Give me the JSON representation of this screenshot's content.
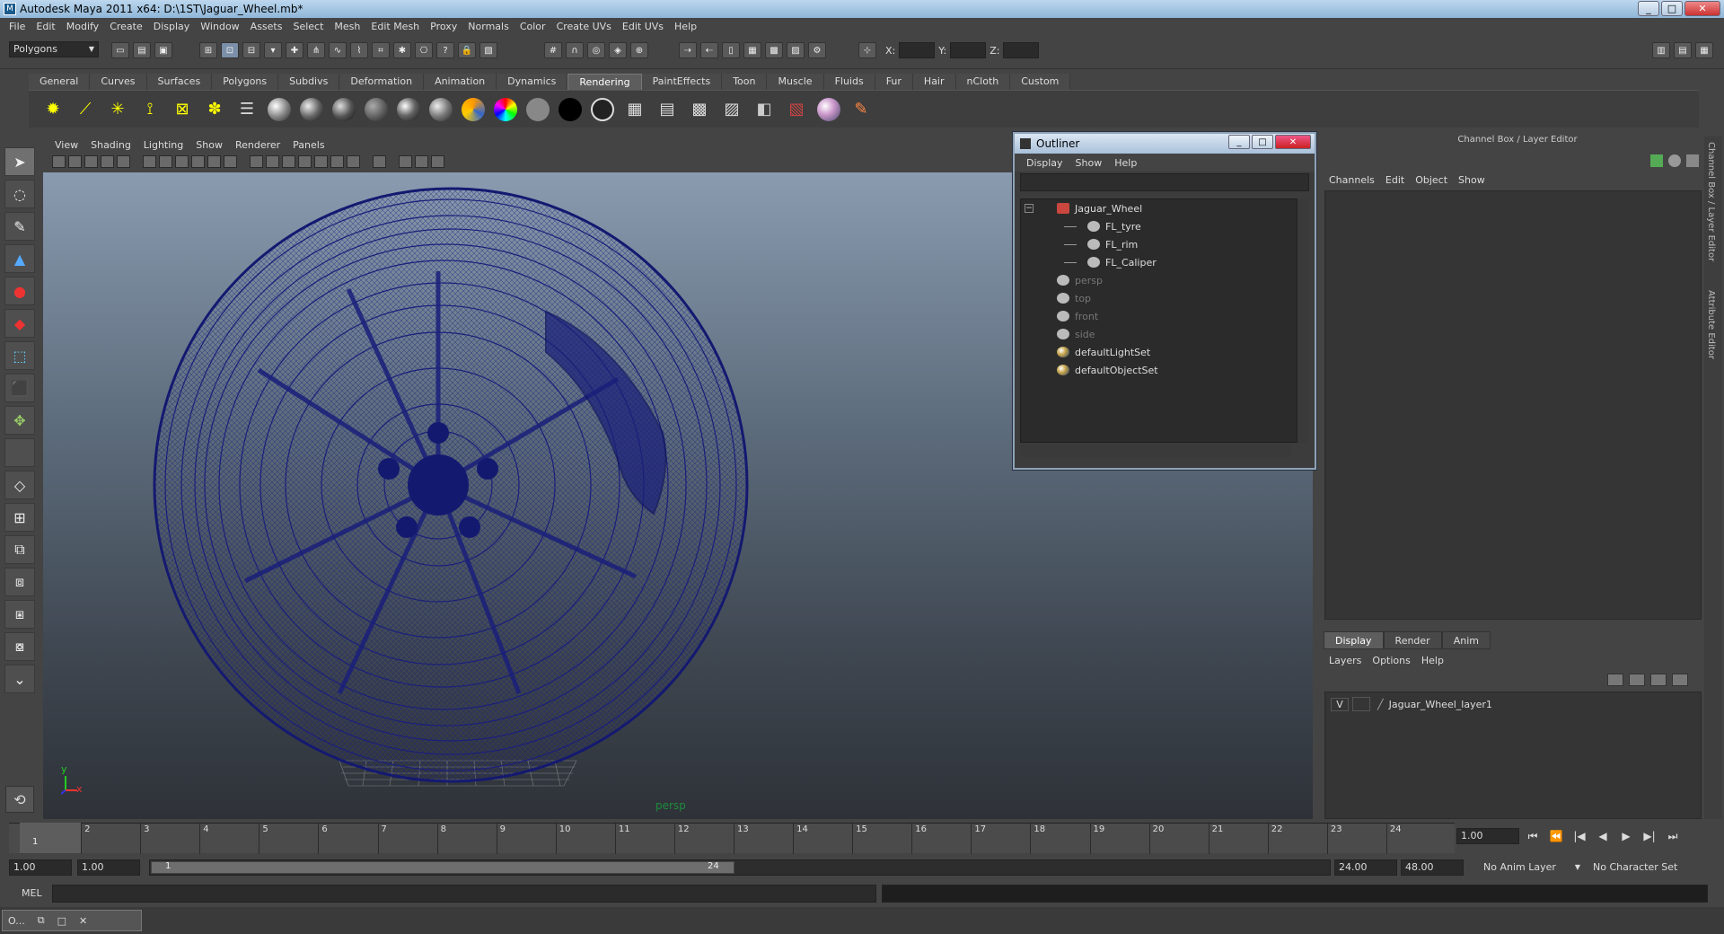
{
  "window": {
    "title": "Autodesk Maya 2011 x64: D:\\1ST\\Jaguar_Wheel.mb*",
    "buttons": [
      "_",
      "□",
      "✕"
    ]
  },
  "menubar": [
    "File",
    "Edit",
    "Modify",
    "Create",
    "Display",
    "Window",
    "Assets",
    "Select",
    "Mesh",
    "Edit Mesh",
    "Proxy",
    "Normals",
    "Color",
    "Create UVs",
    "Edit UVs",
    "Help"
  ],
  "statusline": {
    "mode": "Polygons",
    "x_label": "X:",
    "y_label": "Y:",
    "z_label": "Z:"
  },
  "shelf": {
    "tabs": [
      "General",
      "Curves",
      "Surfaces",
      "Polygons",
      "Subdivs",
      "Deformation",
      "Animation",
      "Dynamics",
      "Rendering",
      "PaintEffects",
      "Toon",
      "Muscle",
      "Fluids",
      "Fur",
      "Hair",
      "nCloth",
      "Custom"
    ],
    "active_tab": "Rendering"
  },
  "viewport": {
    "menu": [
      "View",
      "Shading",
      "Lighting",
      "Show",
      "Renderer",
      "Panels"
    ],
    "camera_label": "persp",
    "axis_x": "x",
    "axis_y": "y"
  },
  "outliner": {
    "title": "Outliner",
    "menu": [
      "Display",
      "Show",
      "Help"
    ],
    "items": [
      {
        "label": "Jaguar_Wheel",
        "type": "group",
        "indent": 0,
        "dim": false
      },
      {
        "label": "FL_tyre",
        "type": "mesh",
        "indent": 1,
        "dim": false
      },
      {
        "label": "FL_rim",
        "type": "mesh",
        "indent": 1,
        "dim": false
      },
      {
        "label": "FL_Caliper",
        "type": "mesh",
        "indent": 1,
        "dim": false
      },
      {
        "label": "persp",
        "type": "camera",
        "indent": 0,
        "dim": true
      },
      {
        "label": "top",
        "type": "camera",
        "indent": 0,
        "dim": true
      },
      {
        "label": "front",
        "type": "camera",
        "indent": 0,
        "dim": true
      },
      {
        "label": "side",
        "type": "camera",
        "indent": 0,
        "dim": true
      },
      {
        "label": "defaultLightSet",
        "type": "set",
        "indent": 0,
        "dim": false
      },
      {
        "label": "defaultObjectSet",
        "type": "set",
        "indent": 0,
        "dim": false
      }
    ]
  },
  "channelbox": {
    "title": "Channel Box / Layer Editor",
    "menu": [
      "Channels",
      "Edit",
      "Object",
      "Show"
    ],
    "side_tabs": [
      "Channel Box / Layer Editor",
      "Attribute Editor"
    ]
  },
  "layers": {
    "tabs": [
      "Display",
      "Render",
      "Anim"
    ],
    "active_tab": "Display",
    "menu": [
      "Layers",
      "Options",
      "Help"
    ],
    "rows": [
      {
        "visible": "V",
        "name": "Jaguar_Wheel_layer1"
      }
    ]
  },
  "timeline": {
    "ticks": [
      "1",
      "2",
      "3",
      "4",
      "5",
      "6",
      "7",
      "8",
      "9",
      "10",
      "11",
      "12",
      "13",
      "14",
      "15",
      "16",
      "17",
      "18",
      "19",
      "20",
      "21",
      "22",
      "23",
      "24"
    ],
    "current_frame": "1",
    "current_time": "1.00",
    "playback_controls": [
      "⏮",
      "⏪",
      "|◀",
      "◀",
      "▶",
      "▶|",
      "⏭"
    ]
  },
  "range": {
    "start_time": "1.00",
    "playback_start": "1.00",
    "slider_start": "1",
    "slider_end": "24",
    "playback_end": "24.00",
    "end_time": "48.00",
    "anim_layer": "No Anim Layer",
    "character_set": "No Character Set"
  },
  "commandline": {
    "label": "MEL"
  },
  "taskbar": {
    "item": "O..."
  },
  "colors": {
    "wire": "#1a1f7a",
    "accent": "#8fb6d8"
  }
}
